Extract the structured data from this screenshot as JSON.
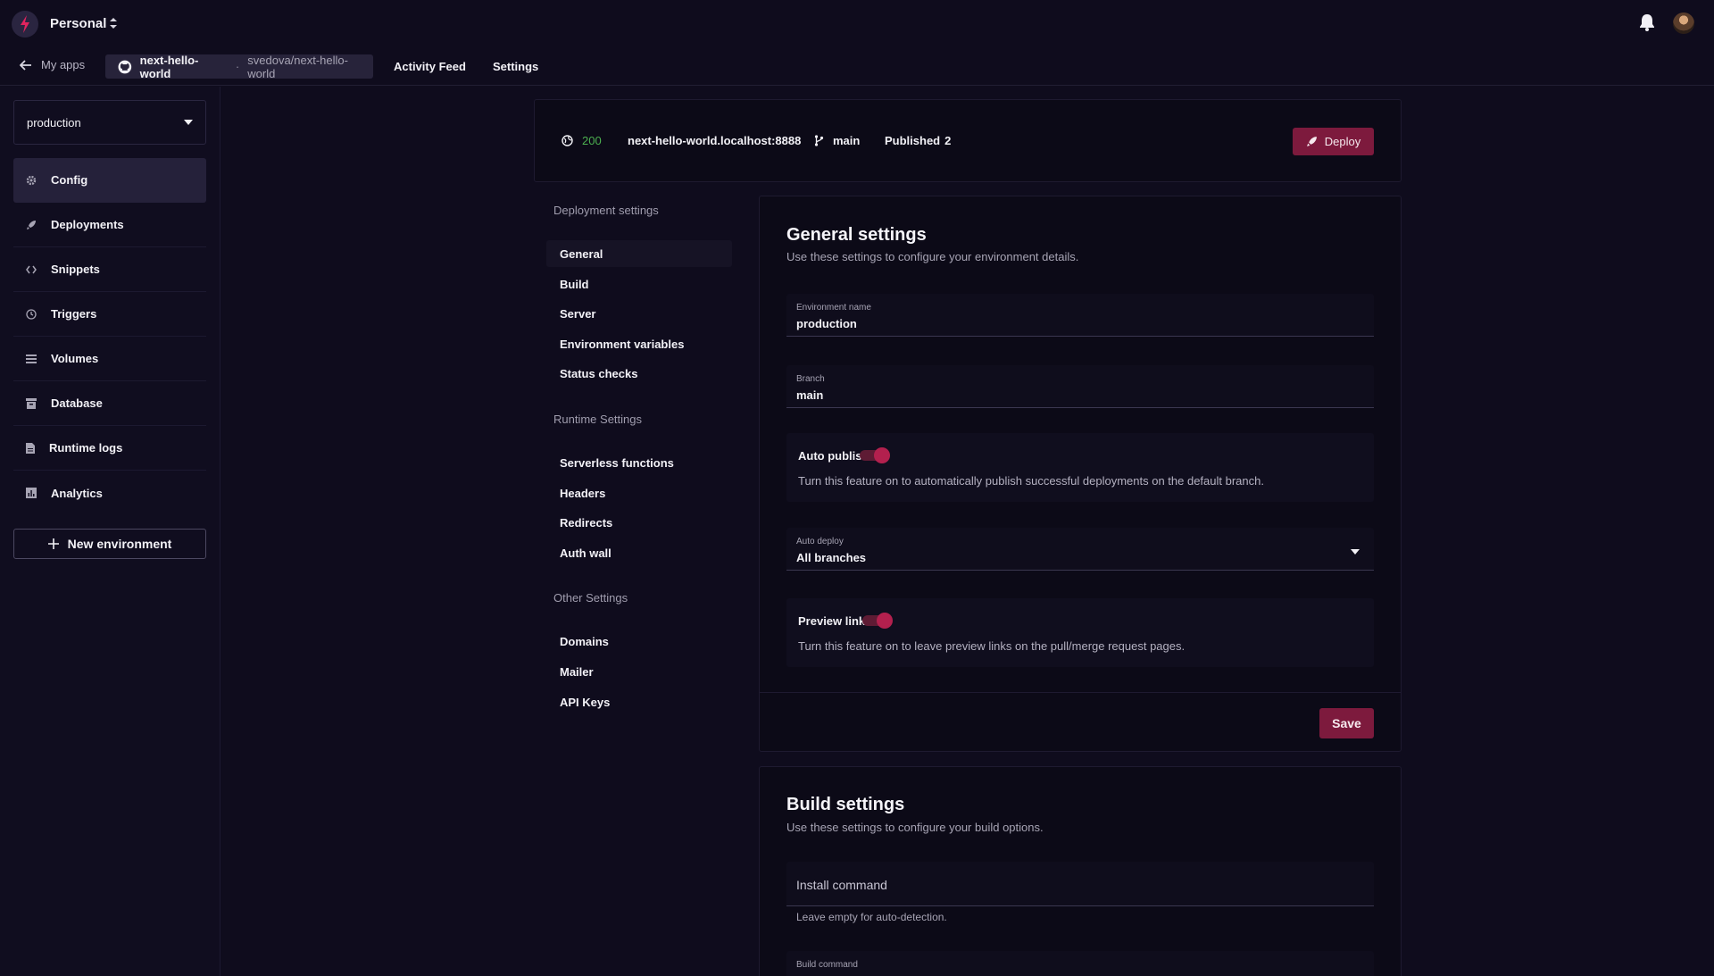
{
  "topbar": {
    "team": "Personal",
    "logo_icon": "bolt-icon",
    "notifications_icon": "bell-icon"
  },
  "nav": {
    "back_label": "My apps",
    "repo_name": "next-hello-world",
    "repo_sep": "·",
    "repo_path": "svedova/next-hello-world",
    "activity_feed": "Activity Feed",
    "settings": "Settings"
  },
  "sidebar": {
    "environment": "production",
    "items": [
      {
        "label": "Config",
        "icon": "gear-icon",
        "active": true
      },
      {
        "label": "Deployments",
        "icon": "rocket-icon"
      },
      {
        "label": "Snippets",
        "icon": "code-icon"
      },
      {
        "label": "Triggers",
        "icon": "clock-icon"
      },
      {
        "label": "Volumes",
        "icon": "list-icon"
      },
      {
        "label": "Database",
        "icon": "archive-icon"
      },
      {
        "label": "Runtime logs",
        "icon": "document-icon"
      },
      {
        "label": "Analytics",
        "icon": "chart-icon"
      }
    ],
    "new_environment": "New environment"
  },
  "status": {
    "code": "200",
    "domain": "next-hello-world.localhost:8888",
    "branch": "main",
    "published_label": "Published",
    "published_count": "2",
    "deploy_label": "Deploy",
    "colors": {
      "ok": "#4caf50",
      "accent": "#7d1a3d"
    }
  },
  "subnav": {
    "deployment_heading": "Deployment settings",
    "deployment_items": [
      "General",
      "Build",
      "Server",
      "Environment variables",
      "Status checks"
    ],
    "runtime_heading": "Runtime Settings",
    "runtime_items": [
      "Serverless functions",
      "Headers",
      "Redirects",
      "Auth wall"
    ],
    "other_heading": "Other Settings",
    "other_items": [
      "Domains",
      "Mailer",
      "API Keys"
    ]
  },
  "general": {
    "title": "General settings",
    "subtitle": "Use these settings to configure your environment details.",
    "env_name_label": "Environment name",
    "env_name_value": "production",
    "branch_label": "Branch",
    "branch_value": "main",
    "auto_publish_label": "Auto publish",
    "auto_publish_on": true,
    "auto_publish_desc": "Turn this feature on to automatically publish successful deployments on the default branch.",
    "auto_deploy_label": "Auto deploy",
    "auto_deploy_value": "All branches",
    "preview_links_label": "Preview links",
    "preview_links_on": true,
    "preview_links_desc": "Turn this feature on to leave preview links on the pull/merge request pages.",
    "save_label": "Save"
  },
  "build": {
    "title": "Build settings",
    "subtitle": "Use these settings to configure your build options.",
    "install_placeholder": "Install command",
    "install_helper": "Leave empty for auto-detection.",
    "build_command_label": "Build command"
  }
}
